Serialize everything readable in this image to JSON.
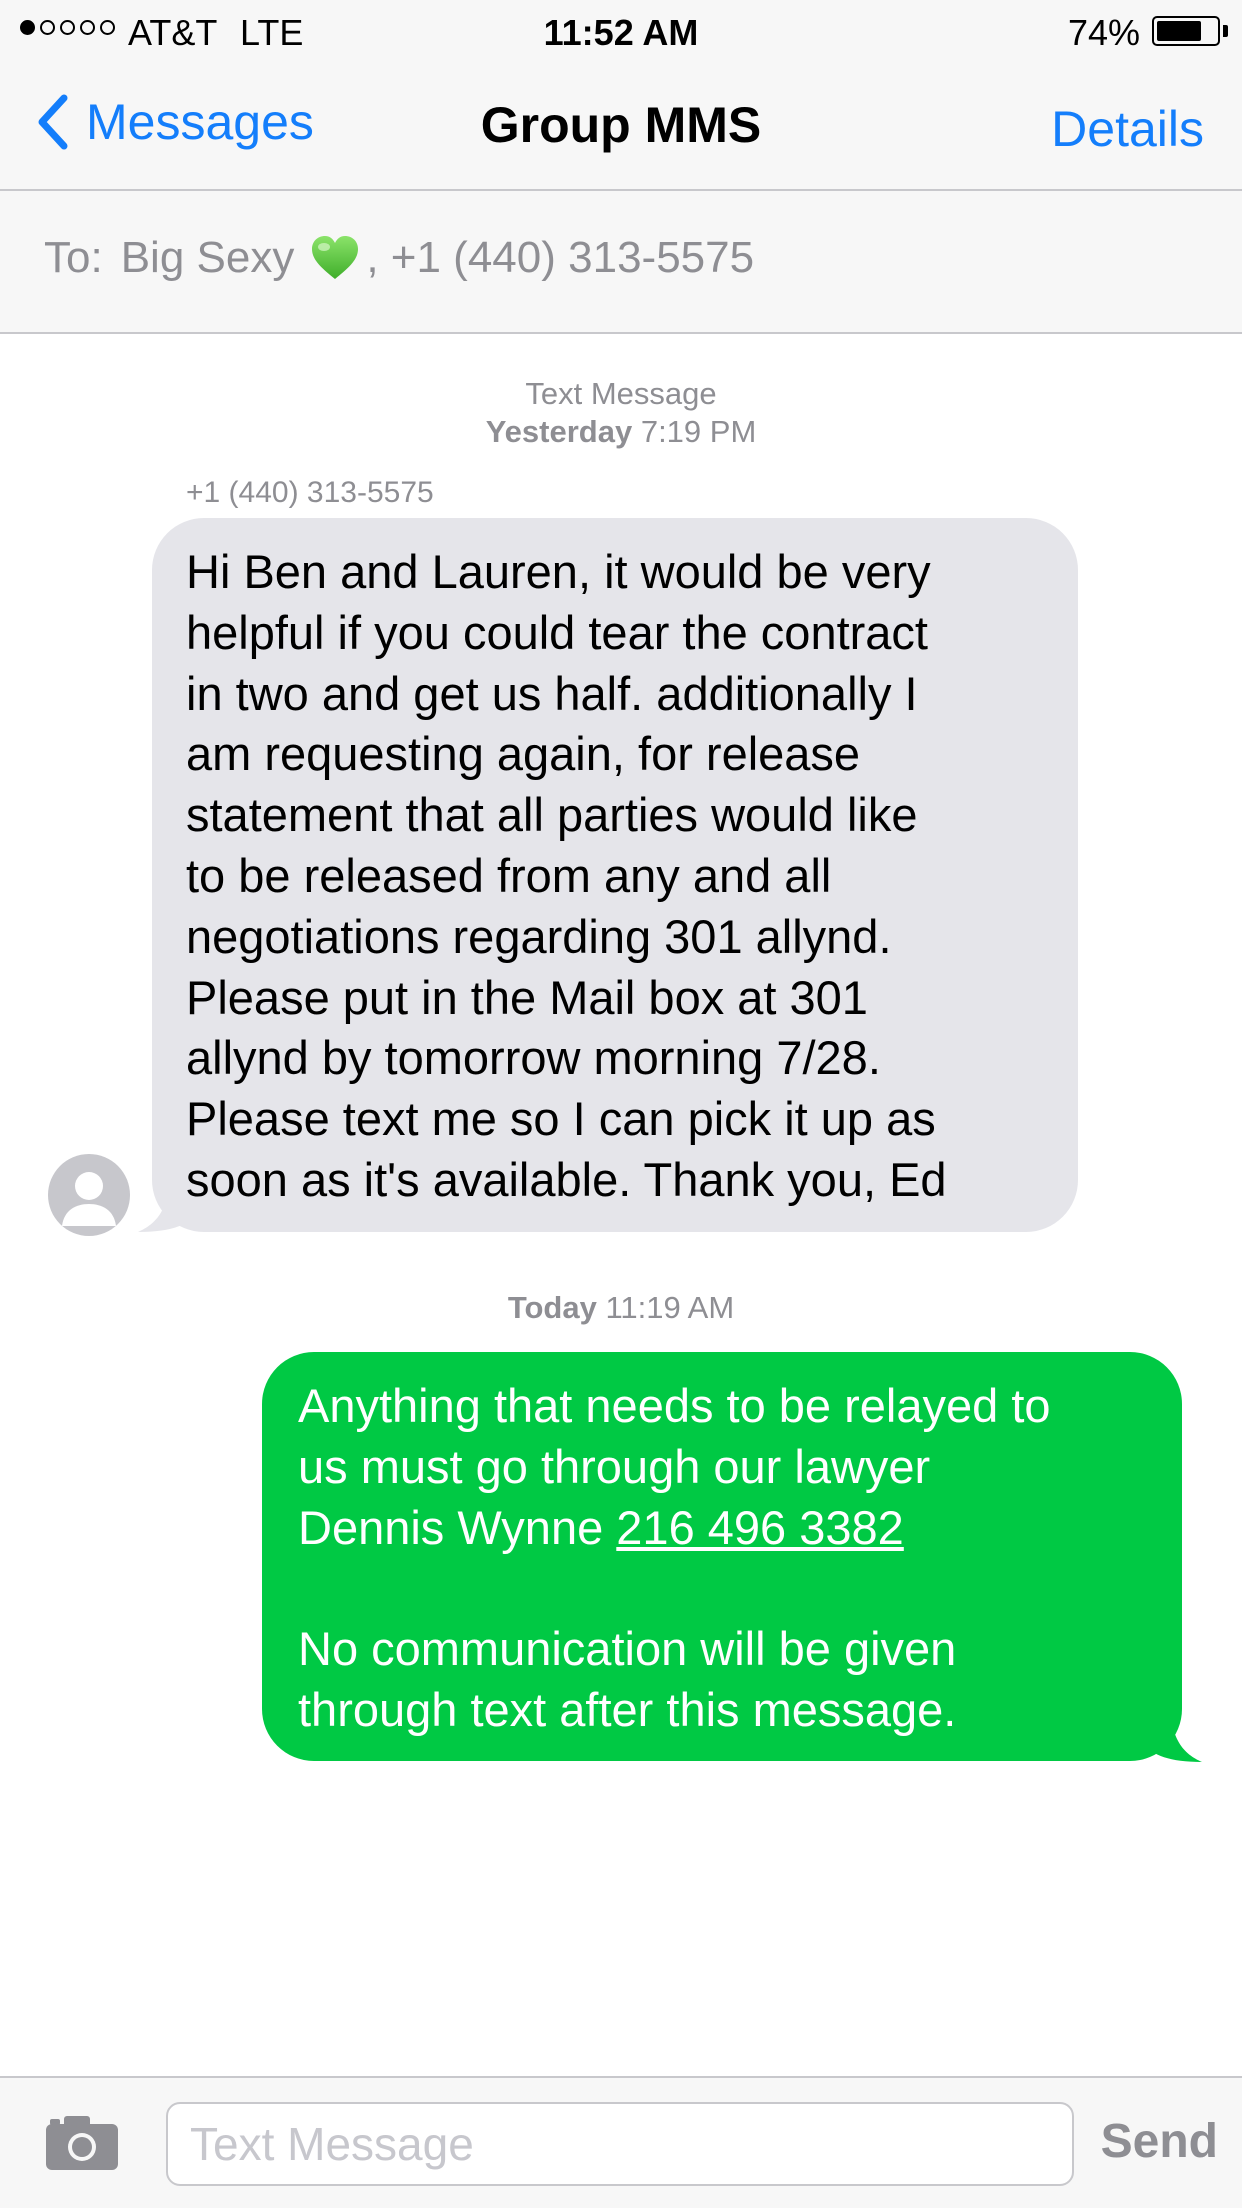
{
  "status_bar": {
    "signal_dots": [
      true,
      false,
      false,
      false,
      false
    ],
    "carrier": "AT&T",
    "network": "LTE",
    "time": "11:52 AM",
    "battery_percent": "74%",
    "battery_level": 0.74
  },
  "nav": {
    "back_label": "Messages",
    "title": "Group MMS",
    "details_label": "Details"
  },
  "to_bar": {
    "label": "To:",
    "recipient_1": "Big Sexy",
    "recipient_1_emoji": "green-heart-icon",
    "recipient_2": ", +1 (440) 313-5575"
  },
  "thread": {
    "header_1": {
      "type": "Text Message",
      "day": "Yesterday",
      "time": "7:19 PM"
    },
    "incoming": {
      "sender": "+1 (440) 313-5575",
      "text": "Hi Ben and Lauren, it would be very\nhelpful if you could tear the contract\nin two and get  us half.  additionally I\nam requesting again, for release\nstatement that all parties would like\nto be released from any and all\nnegotiations regarding  301 allynd.\nPlease put in the Mail box at 301\nallynd by tomorrow morning 7/28.\nPlease text me so I can pick it up as\nsoon as it's available. Thank you, Ed"
    },
    "header_2": {
      "day": "Today",
      "time": "11:19 AM"
    },
    "outgoing": {
      "text_before_link": "Anything that needs to be relayed to\nus must go through our lawyer\nDennis Wynne ",
      "phone_link": "216 496 3382",
      "text_after_link": "\n\nNo communication will be given\nthrough text after this message."
    }
  },
  "input_bar": {
    "placeholder": "Text Message",
    "send_label": "Send"
  },
  "colors": {
    "ios_blue": "#147efb",
    "incoming_bubble": "#e5e5ea",
    "outgoing_bubble": "#00c944",
    "gray_text": "#8e8e93"
  }
}
